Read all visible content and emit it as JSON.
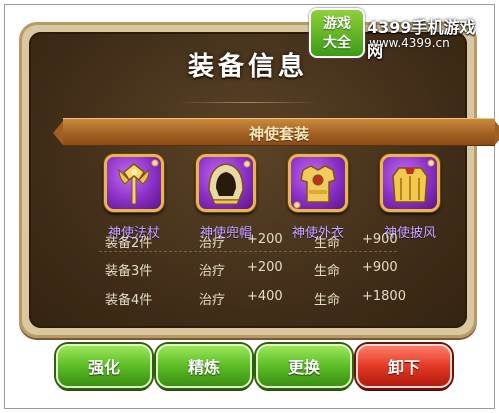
{
  "title": "装备信息",
  "set_name": "神使套装",
  "items": [
    {
      "label": "神使法杖",
      "icon": "staff-icon"
    },
    {
      "label": "神使兜帽",
      "icon": "hood-icon"
    },
    {
      "label": "神使外衣",
      "icon": "armor-icon"
    },
    {
      "label": "神使披风",
      "icon": "cloak-icon"
    }
  ],
  "bonuses": [
    {
      "set": "装备2件",
      "attr1": "治疗",
      "val1": "+200",
      "attr2": "生命",
      "val2": "+900"
    },
    {
      "set": "装备3件",
      "attr1": "治疗",
      "val1": "+200",
      "attr2": "生命",
      "val2": "+900"
    },
    {
      "set": "装备4件",
      "attr1": "治疗",
      "val1": "+400",
      "attr2": "生命",
      "val2": "+1800"
    }
  ],
  "buttons": {
    "strengthen": "强化",
    "refine": "精炼",
    "replace": "更换",
    "unequip": "卸下"
  },
  "watermark": {
    "badge_line1": "游戏",
    "badge_line2": "大全",
    "name": "4399手机游戏网",
    "url": "www.4399.cn"
  },
  "colors": {
    "panel_bg": "#3e2b17",
    "banner": "#a05f22",
    "item_label": "#c8a7ff",
    "button_green": "#5cbd25",
    "button_red": "#e23a24"
  }
}
